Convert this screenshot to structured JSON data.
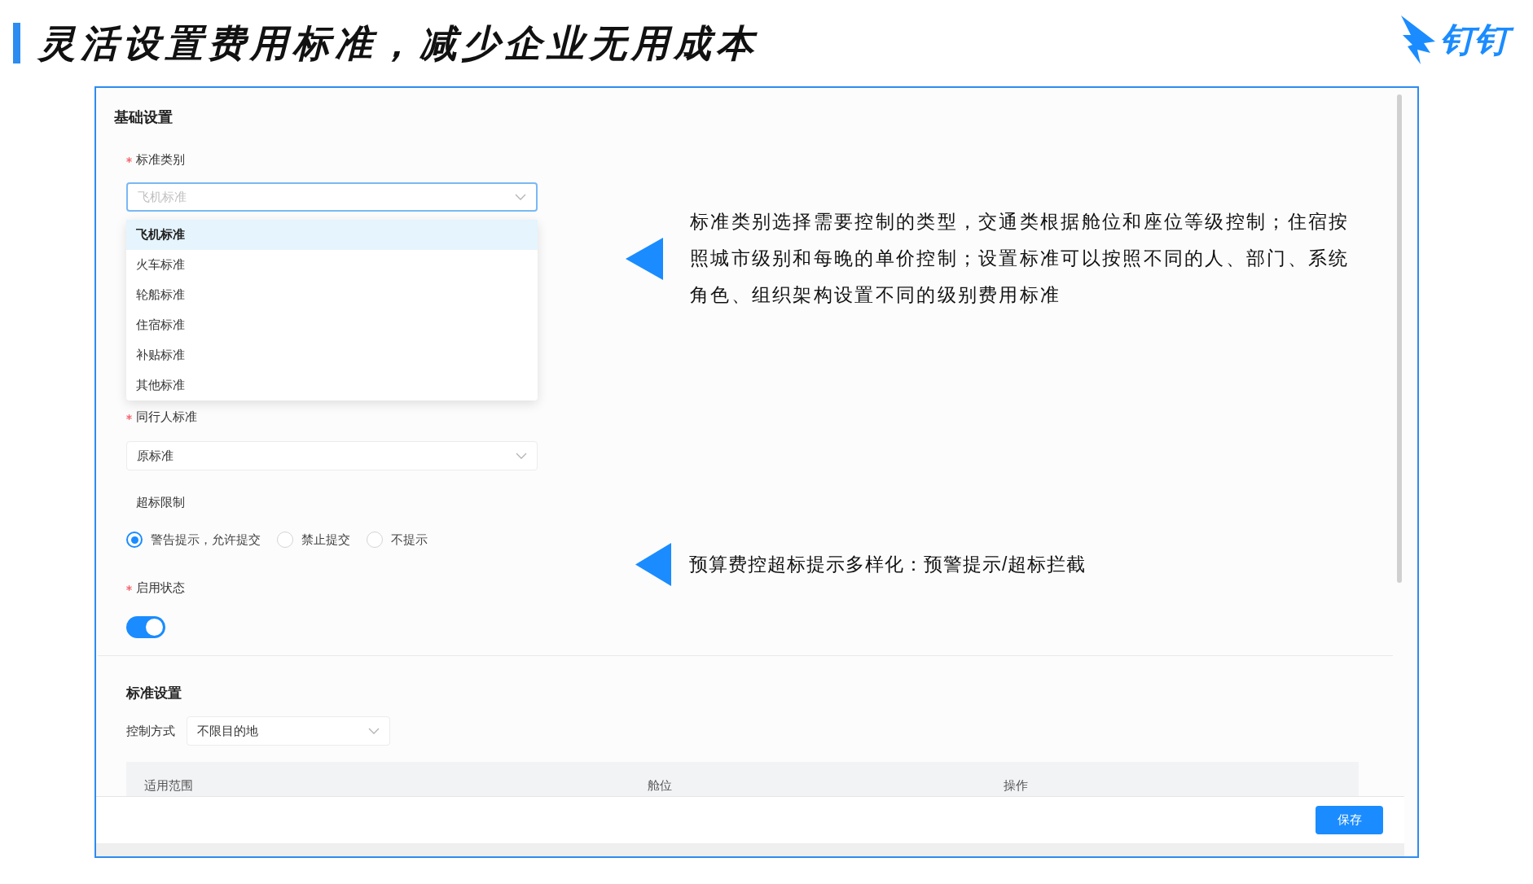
{
  "slide": {
    "title": "灵活设置费用标准，减少企业无用成本",
    "logo_text": "钉钉"
  },
  "basic_settings": {
    "heading": "基础设置",
    "standard_type": {
      "label": "标准类别",
      "required": true,
      "placeholder": "飞机标准",
      "focused": true,
      "options": [
        {
          "label": "飞机标准",
          "selected": true
        },
        {
          "label": "火车标准",
          "selected": false
        },
        {
          "label": "轮船标准",
          "selected": false
        },
        {
          "label": "住宿标准",
          "selected": false
        },
        {
          "label": "补贴标准",
          "selected": false
        },
        {
          "label": "其他标准",
          "selected": false
        }
      ]
    },
    "companion_standard": {
      "label": "同行人标准",
      "required": true,
      "value": "原标准"
    },
    "over_limit": {
      "label": "超标限制",
      "required": false,
      "options": [
        {
          "label": "警告提示，允许提交",
          "selected": true
        },
        {
          "label": "禁止提交",
          "selected": false
        },
        {
          "label": "不提示",
          "selected": false
        }
      ]
    },
    "enabled": {
      "label": "启用状态",
      "required": true,
      "on": true
    }
  },
  "standard_settings": {
    "heading": "标准设置",
    "control_label": "控制方式",
    "control_value": "不限目的地",
    "columns": [
      "适用范围",
      "舱位",
      "操作"
    ]
  },
  "footer": {
    "save_button": "保存"
  },
  "annotations": [
    "标准类别选择需要控制的类型，交通类根据舱位和座位等级控制；住宿按照城市级别和每晚的单价控制；设置标准可以按照不同的人、部门、系统角色、组织架构设置不同的级别费用标准",
    "预算费控超标提示多样化：预警提示/超标拦截"
  ]
}
